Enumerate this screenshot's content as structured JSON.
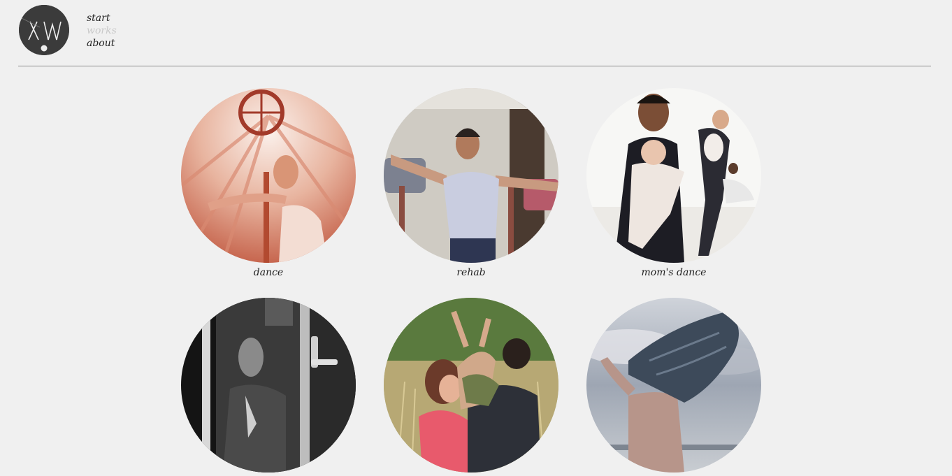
{
  "header": {
    "logo_text": "XW",
    "nav": [
      {
        "label": "start",
        "active": false
      },
      {
        "label": "works",
        "active": true
      },
      {
        "label": "about",
        "active": false
      }
    ]
  },
  "works": [
    {
      "caption": "dance",
      "photo": "dance-photo"
    },
    {
      "caption": "rehab",
      "photo": "rehab-photo"
    },
    {
      "caption": "mom's dance",
      "photo": "moms-dance-photo"
    },
    {
      "caption": "",
      "photo": "door-portrait-photo"
    },
    {
      "caption": "",
      "photo": "family-photo"
    },
    {
      "caption": "",
      "photo": "fabric-dancer-photo"
    }
  ],
  "colors": {
    "background": "#f0f0f0",
    "text": "#222222",
    "nav_active": "#c9c9c9",
    "divider": "#8c8c8c",
    "logo_bg": "#3b3b3b"
  }
}
